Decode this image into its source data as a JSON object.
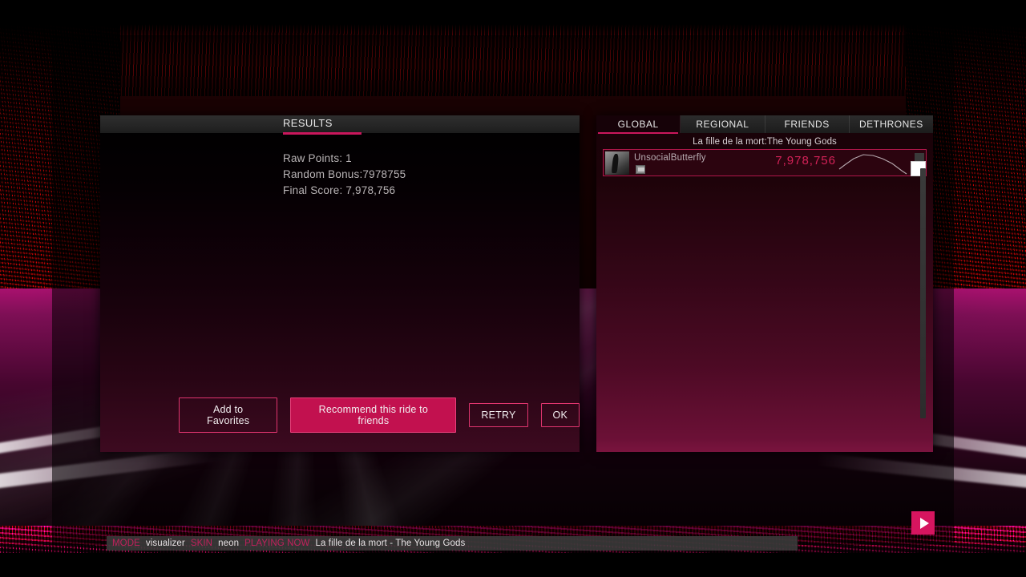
{
  "results": {
    "title": "RESULTS",
    "lines": [
      "Raw Points: 1",
      "Random Bonus:7978755",
      "Final Score: 7,978,756"
    ],
    "raw_points": 1,
    "random_bonus": 7978755,
    "final_score": "7,978,756",
    "buttons": {
      "favorites": "Add to Favorites",
      "recommend": "Recommend this ride to friends",
      "retry": "RETRY",
      "ok": "OK"
    }
  },
  "leaderboard": {
    "tabs": [
      {
        "label": "GLOBAL",
        "active": true
      },
      {
        "label": "REGIONAL",
        "active": false
      },
      {
        "label": "FRIENDS",
        "active": false
      },
      {
        "label": "DETHRONES",
        "active": false
      }
    ],
    "song_line": "La fille de la mort:The Young Gods",
    "entries": [
      {
        "name": "UnsocialButterfly",
        "score": "7,978,756"
      }
    ]
  },
  "statusbar": {
    "mode_key": "MODE",
    "mode_value": "visualizer",
    "skin_key": "SKIN",
    "skin_value": "neon",
    "playing_key": "PLAYING NOW",
    "playing_value": "La fille de la mort - The Young Gods"
  },
  "colors": {
    "accent": "#c9175c",
    "accent_bright": "#d6155f",
    "score": "#d42258",
    "text": "#e6e2e4"
  }
}
